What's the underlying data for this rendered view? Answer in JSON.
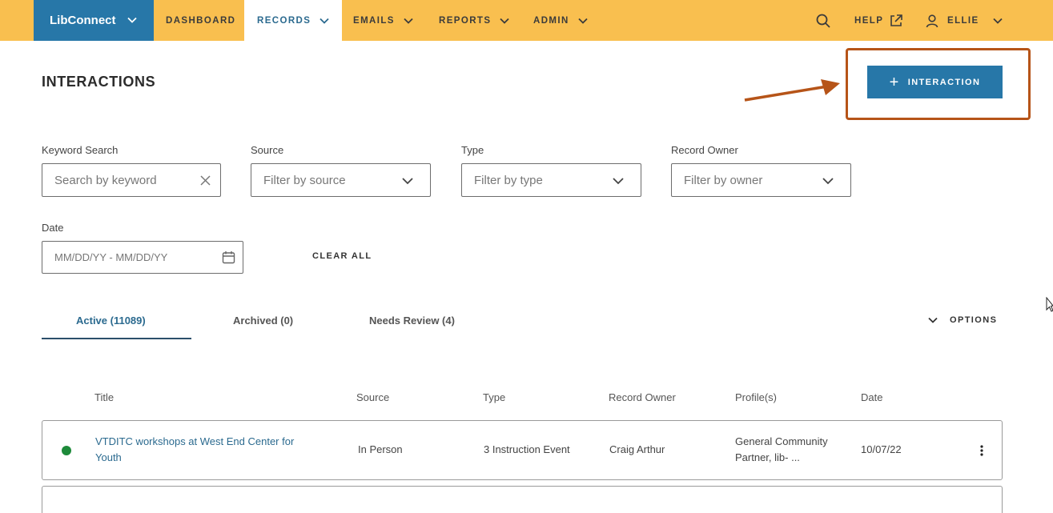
{
  "nav": {
    "brand": "LibConnect",
    "items": [
      "DASHBOARD",
      "RECORDS",
      "EMAILS",
      "REPORTS",
      "ADMIN"
    ],
    "help": "HELP",
    "user": "ELLIE"
  },
  "page": {
    "title": "INTERACTIONS",
    "add_button": "INTERACTION"
  },
  "filters": {
    "keyword_label": "Keyword Search",
    "keyword_placeholder": "Search by keyword",
    "source_label": "Source",
    "source_placeholder": "Filter by source",
    "type_label": "Type",
    "type_placeholder": "Filter by type",
    "owner_label": "Record Owner",
    "owner_placeholder": "Filter by owner",
    "date_label": "Date",
    "date_placeholder": "MM/DD/YY - MM/DD/YY",
    "clear_all": "CLEAR ALL"
  },
  "tabs": [
    "Active (11089)",
    "Archived (0)",
    "Needs Review (4)"
  ],
  "options_label": "OPTIONS",
  "table": {
    "columns": [
      "Title",
      "Source",
      "Type",
      "Record Owner",
      "Profile(s)",
      "Date"
    ],
    "rows": [
      {
        "title_line1": "VTDITC workshops at West End Center for",
        "title_line2": "Youth",
        "source": "In Person",
        "type": "3 Instruction Event",
        "owner": "Craig Arthur",
        "profiles_line1": "General Community",
        "profiles_line2": "Partner, lib- ...",
        "date": "10/07/22"
      }
    ]
  },
  "colors": {
    "nav_bg": "#f9bf4f",
    "brand_blue": "#2777a8",
    "highlight": "#b65418",
    "status_active": "#1d8a3a"
  }
}
